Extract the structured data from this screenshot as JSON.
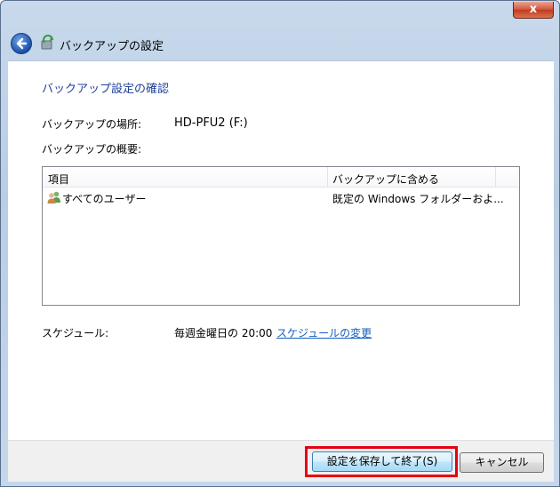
{
  "window": {
    "title": "バックアップの設定",
    "close_glyph": "x"
  },
  "content": {
    "heading": "バックアップ設定の確認",
    "location_label": "バックアップの場所:",
    "location_value": "HD-PFU2 (F:)",
    "summary_label": "バックアップの概要:",
    "table": {
      "columns": [
        "項目",
        "バックアップに含める"
      ],
      "rows": [
        {
          "icon": "users-icon",
          "item": "すべてのユーザー",
          "included": "既定の Windows フォルダーおよ..."
        }
      ]
    },
    "schedule_label": "スケジュール:",
    "schedule_value": "毎週金曜日の 20:00",
    "schedule_link": "スケジュールの変更"
  },
  "footer": {
    "save_button": "設定を保存して終了(S)",
    "cancel_button": "キャンセル"
  },
  "colors": {
    "heading": "#1e3f9b",
    "link": "#1560bd",
    "highlight": "#e60012"
  }
}
